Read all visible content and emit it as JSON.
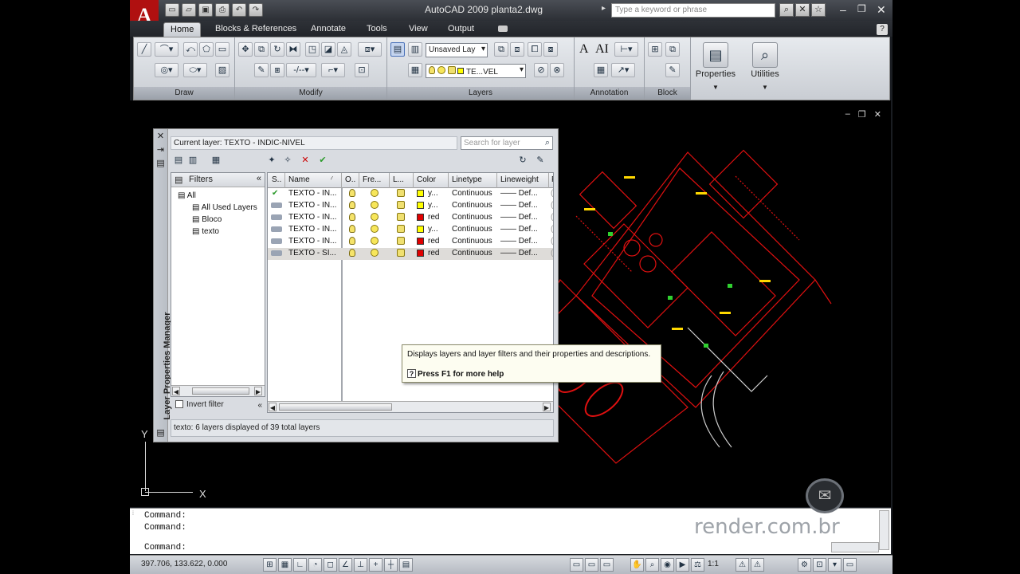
{
  "titlebar": {
    "logo": "A",
    "title": "AutoCAD 2009  planta2.dwg",
    "search_placeholder": "Type a keyword or phrase",
    "qat_icons": [
      "new-icon",
      "open-icon",
      "save-icon",
      "print-icon",
      "undo-icon",
      "redo-icon"
    ],
    "right_icons": [
      "binoculars-icon",
      "tools-icon",
      "star-icon"
    ],
    "controls": {
      "minimize": "–",
      "restore": "❐",
      "close": "✕"
    }
  },
  "tabs": [
    {
      "label": "Home",
      "active": true
    },
    {
      "label": "Blocks & References",
      "active": false
    },
    {
      "label": "Annotate",
      "active": false
    },
    {
      "label": "Tools",
      "active": false
    },
    {
      "label": "View",
      "active": false
    },
    {
      "label": "Output",
      "active": false
    }
  ],
  "help_label": "?",
  "ribbon": {
    "panels": [
      {
        "title": "Draw"
      },
      {
        "title": "Modify"
      },
      {
        "title": "Layers"
      },
      {
        "title": "Annotation"
      },
      {
        "title": "Block"
      }
    ],
    "layer_state": "Unsaved Lay",
    "layer_combo": "TE...VEL",
    "annotation_text": [
      "A",
      "AI"
    ],
    "properties_label": "Properties",
    "utilities_label": "Utilities"
  },
  "drawing": {
    "ucs_y": "Y",
    "ucs_x": "X",
    "controls": [
      "–",
      "❐",
      "✕"
    ]
  },
  "layer_palette": {
    "vertical_title": "Layer Properties Manager",
    "current_layer": "Current layer: TEXTO - INDIC-NIVEL",
    "search_placeholder": "Search for layer",
    "filters_header": "Filters",
    "filter_tree": [
      {
        "label": "All",
        "selected": false
      },
      {
        "label": "All Used Layers",
        "selected": false
      },
      {
        "label": "Bloco",
        "selected": false
      },
      {
        "label": "texto",
        "selected": true
      }
    ],
    "invert_filter": "Invert filter",
    "columns": [
      "S..",
      "Name",
      "O..",
      "Fre...",
      "L...",
      "Color",
      "Linetype",
      "Lineweight",
      "P"
    ],
    "rows": [
      {
        "status": "✔",
        "name": "TEXTO - IN...",
        "color_name": "y...",
        "color": "#ffff00",
        "linetype": "Continuous",
        "lineweight": "—— Def...",
        "current": true,
        "selected": false
      },
      {
        "status": "",
        "name": "TEXTO - IN...",
        "color_name": "y...",
        "color": "#ffff00",
        "linetype": "Continuous",
        "lineweight": "—— Def...",
        "current": false,
        "selected": false
      },
      {
        "status": "",
        "name": "TEXTO - IN...",
        "color_name": "red",
        "color": "#e00000",
        "linetype": "Continuous",
        "lineweight": "—— Def...",
        "current": false,
        "selected": false
      },
      {
        "status": "",
        "name": "TEXTO - IN...",
        "color_name": "y...",
        "color": "#ffff00",
        "linetype": "Continuous",
        "lineweight": "—— Def...",
        "current": false,
        "selected": false
      },
      {
        "status": "",
        "name": "TEXTO - IN...",
        "color_name": "red",
        "color": "#e00000",
        "linetype": "Continuous",
        "lineweight": "—— Def...",
        "current": false,
        "selected": false
      },
      {
        "status": "",
        "name": "TEXTO - SI...",
        "color_name": "red",
        "color": "#e00000",
        "linetype": "Continuous",
        "lineweight": "—— Def...",
        "current": false,
        "selected": true
      }
    ],
    "status_text": "texto: 6 layers displayed of 39 total layers",
    "tooltip": {
      "description": "Displays layers and layer filters and their properties and descriptions.",
      "help": "Press F1 for more help"
    }
  },
  "command_line": {
    "lines": [
      "Command:",
      "Command:",
      "Command:"
    ]
  },
  "watermark": "render.com.br",
  "statusbar": {
    "coordinates": "397.706, 133.622, 0.000",
    "scale": "1:1"
  }
}
